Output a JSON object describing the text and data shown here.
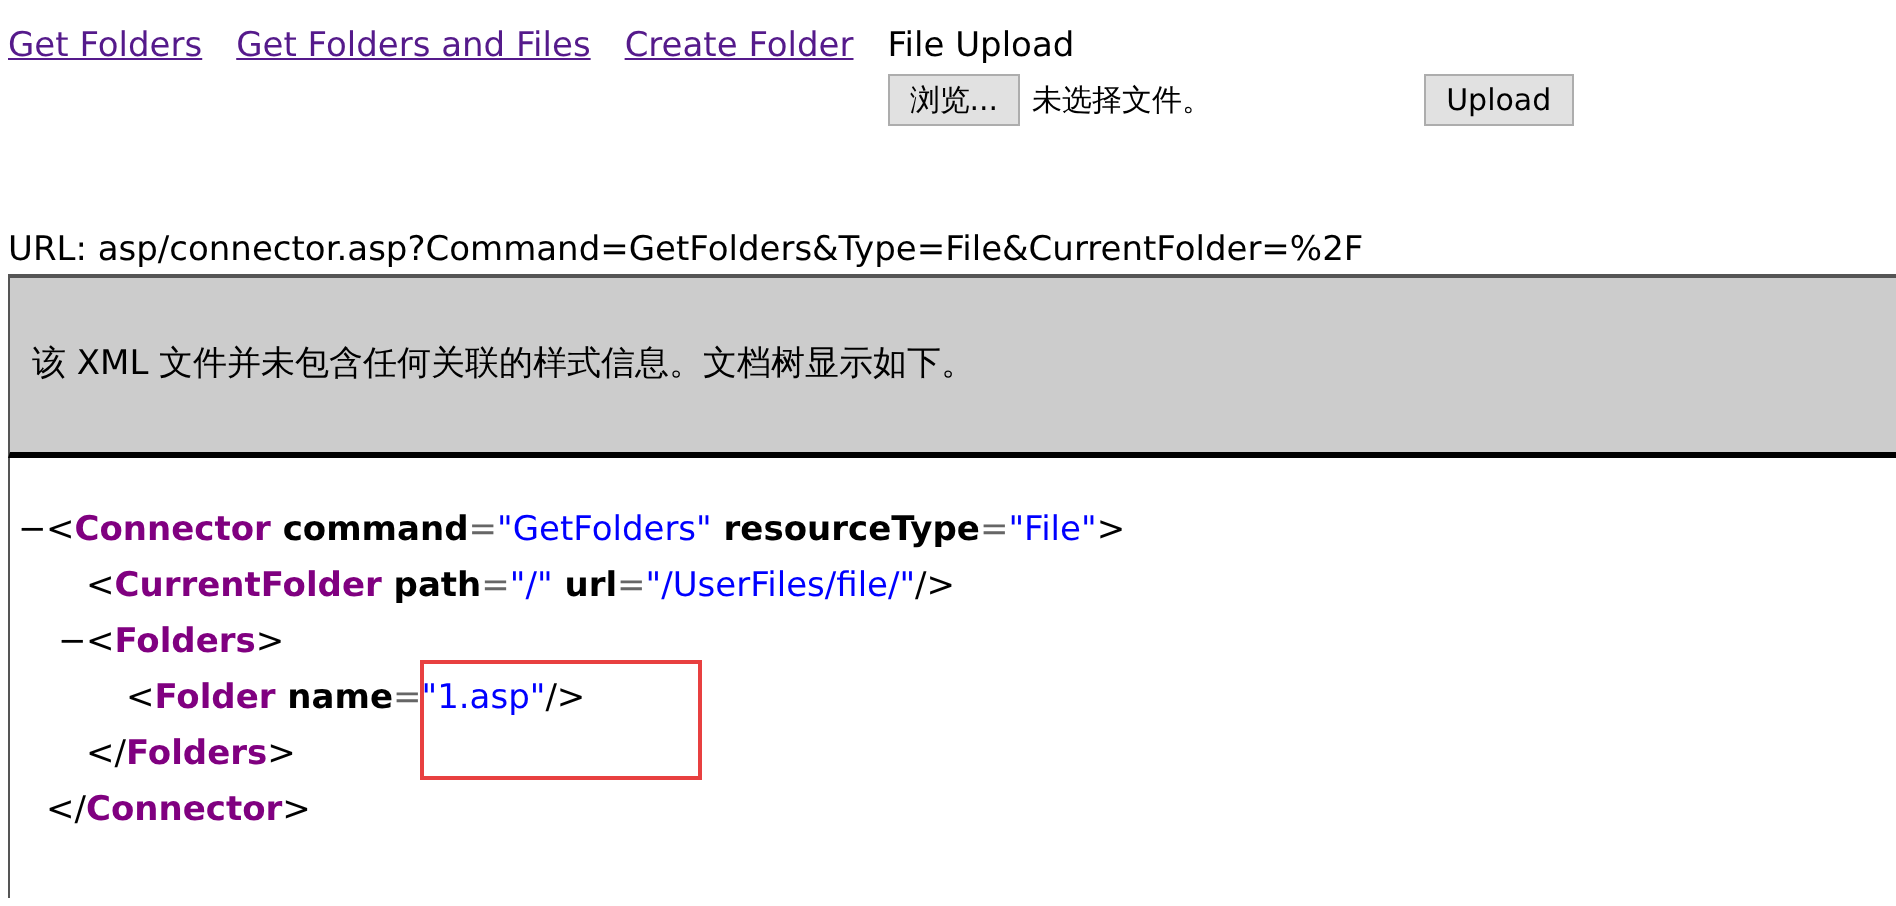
{
  "nav_links": [
    {
      "label": "Get Folders"
    },
    {
      "label": "Get Folders and Files"
    },
    {
      "label": "Create Folder"
    }
  ],
  "upload": {
    "title": "File Upload",
    "browse_button": "浏览...",
    "file_status": "未选择文件。",
    "upload_button": "Upload"
  },
  "url_line": "URL: asp/connector.asp?Command=GetFolders&Type=File&CurrentFolder=%2F",
  "xml_notice": "该 XML 文件并未包含任何关联的样式信息。文档树显示如下。",
  "xml_tree": [
    {
      "toggle": "−",
      "highlighted": false,
      "start": [
        {
          "kind": "punct",
          "text": "<"
        },
        {
          "kind": "tag",
          "text": "Connector"
        },
        {
          "kind": "attr",
          "text": " command"
        },
        {
          "kind": "eq",
          "text": "="
        },
        {
          "kind": "value",
          "text": "\"GetFolders\""
        },
        {
          "kind": "attr",
          "text": " resourceType"
        },
        {
          "kind": "eq",
          "text": "="
        },
        {
          "kind": "value",
          "text": "\"File\""
        },
        {
          "kind": "punct",
          "text": ">"
        }
      ],
      "children": [
        {
          "highlighted": false,
          "start": [
            {
              "kind": "punct",
              "text": "<"
            },
            {
              "kind": "tag",
              "text": "CurrentFolder"
            },
            {
              "kind": "attr",
              "text": " path"
            },
            {
              "kind": "eq",
              "text": "="
            },
            {
              "kind": "value",
              "text": "\"/\""
            },
            {
              "kind": "attr",
              "text": " url"
            },
            {
              "kind": "eq",
              "text": "="
            },
            {
              "kind": "value",
              "text": "\"/UserFiles/file/\""
            },
            {
              "kind": "punct",
              "text": "/>"
            }
          ]
        },
        {
          "toggle": "−",
          "highlighted": false,
          "start": [
            {
              "kind": "punct",
              "text": "<"
            },
            {
              "kind": "tag",
              "text": "Folders"
            },
            {
              "kind": "punct",
              "text": ">"
            }
          ],
          "children": [
            {
              "highlighted": true,
              "start": [
                {
                  "kind": "punct",
                  "text": "<"
                },
                {
                  "kind": "tag",
                  "text": "Folder"
                },
                {
                  "kind": "attr",
                  "text": " name"
                },
                {
                  "kind": "eq",
                  "text": "="
                },
                {
                  "kind": "value",
                  "text": "\"1.asp\""
                },
                {
                  "kind": "punct",
                  "text": "/>"
                }
              ]
            }
          ],
          "end": [
            {
              "kind": "punct",
              "text": "</"
            },
            {
              "kind": "tag",
              "text": "Folders"
            },
            {
              "kind": "punct",
              "text": ">"
            }
          ]
        }
      ],
      "end": [
        {
          "kind": "punct",
          "text": "</"
        },
        {
          "kind": "tag",
          "text": "Connector"
        },
        {
          "kind": "punct",
          "text": ">"
        }
      ]
    }
  ]
}
